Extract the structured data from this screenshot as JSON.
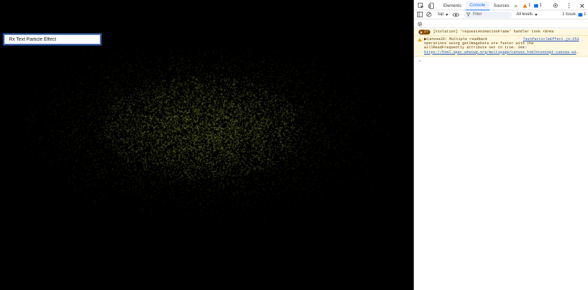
{
  "page": {
    "input_value": "Rx Text Particle Effect",
    "canvas": {
      "background": "#000000",
      "particle_color_core": "#8a9a3a",
      "particle_color_edge": "#4a5a1c",
      "particle_count": 9000,
      "spread_x": 0.31,
      "spread_y": 0.22,
      "seed": 7
    }
  },
  "devtools": {
    "tabs": [
      "Elements",
      "Console",
      "Sources"
    ],
    "active_tab": "Console",
    "more_tabs": "»",
    "warning_count": "1",
    "message_count": "1",
    "context": "top",
    "filter_placeholder": "Filter",
    "levels": "All levels",
    "issues_label": "1 Issue:",
    "issues_count": "1",
    "violation_count": "27",
    "violation_text": "[Violation] 'requestAnimationFrame' handler took <N>ms",
    "warning_line1": "▶Canvas2D: Multiple readback",
    "warning_source": "TextParticleEffect.js:253",
    "warning_line2": "operations using getImageData are faster with the",
    "warning_line3": "willReadFrequently attribute set to true. See:",
    "warning_link": "https://html.spec.whatwg.org/multipage/canvas.html#concept-canvas-will-read-frequently",
    "prompt_symbol": "›",
    "accent": "#1a73e8",
    "warning_accent": "#e8710a"
  }
}
